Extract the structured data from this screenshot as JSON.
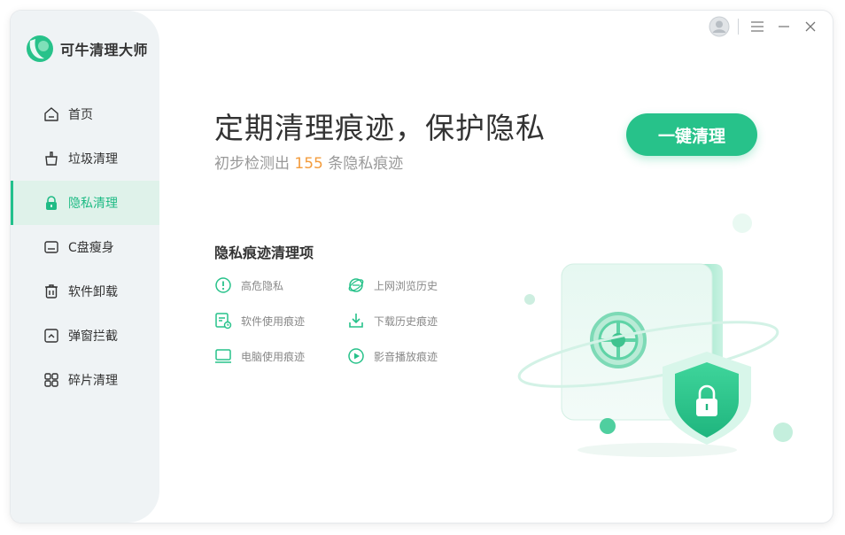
{
  "app": {
    "name": "可牛清理大师"
  },
  "sidebar": {
    "items": [
      {
        "label": "首页",
        "icon": "home-icon"
      },
      {
        "label": "垃圾清理",
        "icon": "trash-clean-icon"
      },
      {
        "label": "隐私清理",
        "icon": "lock-icon",
        "active": true
      },
      {
        "label": "C盘瘦身",
        "icon": "disk-icon"
      },
      {
        "label": "软件卸载",
        "icon": "uninstall-icon"
      },
      {
        "label": "弹窗拦截",
        "icon": "popup-block-icon"
      },
      {
        "label": "碎片清理",
        "icon": "grid-icon"
      }
    ]
  },
  "main": {
    "headline": "定期清理痕迹，保护隐私",
    "sub_prefix": "初步检测出 ",
    "trace_count": "155",
    "sub_suffix": " 条隐私痕迹",
    "cta_label": "一键清理",
    "section_title": "隐私痕迹清理项",
    "items": [
      {
        "label": "高危隐私",
        "icon": "warning-icon"
      },
      {
        "label": "上网浏览历史",
        "icon": "browser-icon"
      },
      {
        "label": "软件使用痕迹",
        "icon": "software-trace-icon"
      },
      {
        "label": "下载历史痕迹",
        "icon": "download-icon"
      },
      {
        "label": "电脑使用痕迹",
        "icon": "computer-icon"
      },
      {
        "label": "影音播放痕迹",
        "icon": "play-icon"
      }
    ]
  },
  "colors": {
    "accent": "#27c28a",
    "count": "#f39c3d",
    "sidebar_bg": "#eff3f5"
  }
}
